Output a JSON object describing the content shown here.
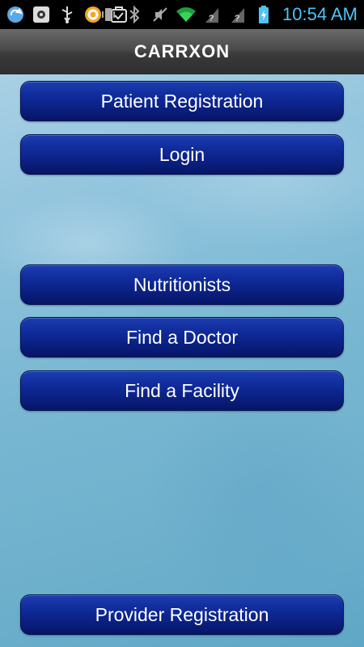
{
  "status_bar": {
    "time": "10:54 AM",
    "icons_left": [
      "sync-icon",
      "settings-app-icon",
      "usb-icon",
      "circle-app-icon",
      "checklist-icon"
    ],
    "icons_right": [
      "vibrate-icon",
      "bluetooth-icon",
      "mute-icon",
      "wifi-icon",
      "signal-icon",
      "signal-icon",
      "battery-icon"
    ]
  },
  "app_title": "CARRXON",
  "buttons": {
    "patient_registration": "Patient Registration",
    "login": "Login",
    "nutritionists": "Nutritionists",
    "find_doctor": "Find a Doctor",
    "find_facility": "Find a Facility",
    "provider_registration": "Provider Registration"
  },
  "colors": {
    "button_blue": "#0f2a98",
    "clock_blue": "#4fc3f7",
    "background_blue": "#79b7d2"
  }
}
